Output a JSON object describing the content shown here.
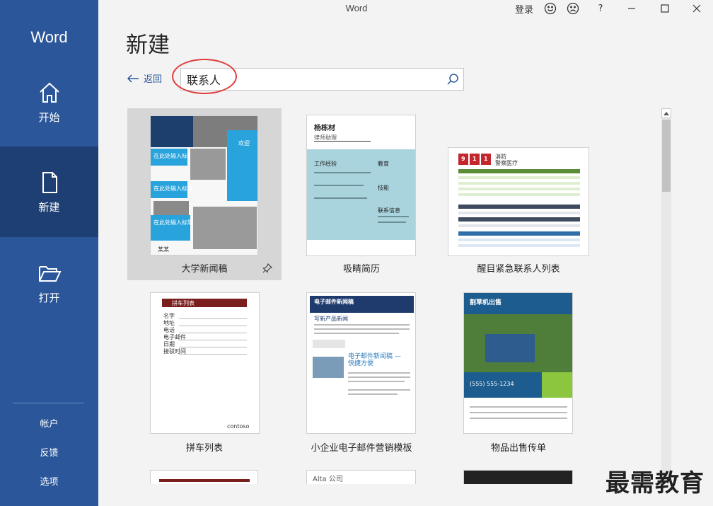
{
  "window": {
    "title": "Word",
    "signin_label": "登录",
    "help_label": "?"
  },
  "sidebar": {
    "brand": "Word",
    "items": [
      {
        "label": "开始"
      },
      {
        "label": "新建"
      },
      {
        "label": "打开"
      }
    ],
    "bottom_links": [
      "帐户",
      "反馈",
      "选项"
    ]
  },
  "main": {
    "title": "新建",
    "back_label": "返回",
    "search_value": "联系人"
  },
  "templates": [
    {
      "label": "大学新闻稿",
      "mini": {
        "banner": "欢迎",
        "head1": "在此处输入标题",
        "head2": "在此处输入标题",
        "head3": "在此处输入标题",
        "footer": "某某"
      }
    },
    {
      "label": "吸睛简历",
      "mini": {
        "name": "杨栋材",
        "subtitle": "律师助理",
        "section1": "工作经验",
        "section2": "教育",
        "section3": "技能",
        "section4": "联系信息"
      }
    },
    {
      "label": "醒目紧急联系人列表",
      "mini": {
        "digits": [
          "9",
          "1",
          "1"
        ],
        "line1": "消防",
        "line2": "警察医疗"
      }
    },
    {
      "label": "拼车列表",
      "mini": {
        "header": "拼车列表",
        "rows": [
          "名字",
          "地址",
          "电话",
          "电子邮件",
          "日期",
          "接驳时间"
        ],
        "logo": "contoso"
      }
    },
    {
      "label": "小企业电子邮件营销模板",
      "mini": {
        "header": "电子邮件新闻稿",
        "section": "写新产品新闻",
        "big1": "电子邮件新闻稿 —",
        "big2": "快捷方便"
      }
    },
    {
      "label": "物品出售传单",
      "mini": {
        "header": "割草机出售",
        "price": "(555) 555-1234"
      }
    }
  ],
  "partial_row": {
    "visible_text": "Alta 公司"
  },
  "watermark": "最需教育",
  "colors": {
    "sidebar": "#2b579a",
    "sidebar_active": "#1e3f73",
    "accent_link": "#2b579a",
    "highlight_circle": "#e03c3c"
  }
}
